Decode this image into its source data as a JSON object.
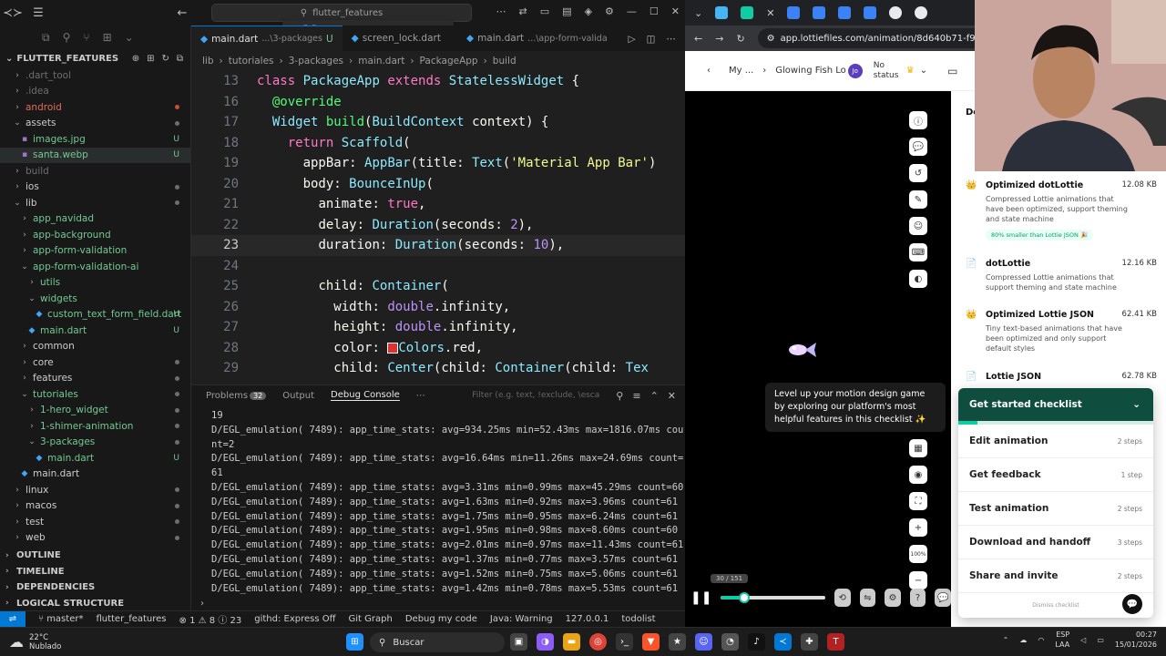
{
  "vscode": {
    "search": "flutter_features",
    "sidebar": {
      "title": "FLUTTER_FEATURES",
      "tree": [
        {
          "label": ".dart_tool",
          "indent": 1,
          "chev": "›",
          "color": "#6e6e6e",
          "mark": "",
          "dot": ""
        },
        {
          "label": ".idea",
          "indent": 1,
          "chev": "›",
          "color": "#6e6e6e",
          "mark": "",
          "dot": ""
        },
        {
          "label": "android",
          "indent": 1,
          "chev": "›",
          "color": "#e06c55",
          "mark": "",
          "dot": "red"
        },
        {
          "label": "assets",
          "indent": 1,
          "chev": "⌄",
          "color": "#cccccc",
          "mark": "",
          "dot": "gray"
        },
        {
          "label": "images.jpg",
          "indent": 2,
          "chev": "",
          "color": "#73c991",
          "mark": "U",
          "dot": ""
        },
        {
          "label": "santa.webp",
          "indent": 2,
          "chev": "",
          "color": "#73c991",
          "mark": "U",
          "dot": ""
        },
        {
          "label": "build",
          "indent": 1,
          "chev": "›",
          "color": "#6e6e6e",
          "mark": "",
          "dot": ""
        },
        {
          "label": "ios",
          "indent": 1,
          "chev": "›",
          "color": "#cccccc",
          "mark": "",
          "dot": "gray"
        },
        {
          "label": "lib",
          "indent": 1,
          "chev": "⌄",
          "color": "#cccccc",
          "mark": "",
          "dot": "gray"
        },
        {
          "label": "app_navidad",
          "indent": 2,
          "chev": "›",
          "color": "#73c991",
          "mark": "",
          "dot": ""
        },
        {
          "label": "app-background",
          "indent": 2,
          "chev": "›",
          "color": "#73c991",
          "mark": "",
          "dot": ""
        },
        {
          "label": "app-form-validation",
          "indent": 2,
          "chev": "›",
          "color": "#73c991",
          "mark": "",
          "dot": ""
        },
        {
          "label": "app-form-validation-ai",
          "indent": 2,
          "chev": "⌄",
          "color": "#73c991",
          "mark": "",
          "dot": ""
        },
        {
          "label": "utils",
          "indent": 3,
          "chev": "›",
          "color": "#73c991",
          "mark": "",
          "dot": ""
        },
        {
          "label": "widgets",
          "indent": 3,
          "chev": "⌄",
          "color": "#73c991",
          "mark": "",
          "dot": ""
        },
        {
          "label": "custom_text_form_field.dart",
          "indent": 4,
          "chev": "",
          "color": "#73c991",
          "mark": "U",
          "dot": ""
        },
        {
          "label": "main.dart",
          "indent": 3,
          "chev": "",
          "color": "#73c991",
          "mark": "U",
          "dot": ""
        },
        {
          "label": "common",
          "indent": 2,
          "chev": "›",
          "color": "#cccccc",
          "mark": "",
          "dot": ""
        },
        {
          "label": "core",
          "indent": 2,
          "chev": "›",
          "color": "#cccccc",
          "mark": "",
          "dot": "gray"
        },
        {
          "label": "features",
          "indent": 2,
          "chev": "›",
          "color": "#cccccc",
          "mark": "",
          "dot": "gray"
        },
        {
          "label": "tutoriales",
          "indent": 2,
          "chev": "⌄",
          "color": "#73c991",
          "mark": "",
          "dot": "gray"
        },
        {
          "label": "1-hero_widget",
          "indent": 3,
          "chev": "›",
          "color": "#73c991",
          "mark": "",
          "dot": "gray"
        },
        {
          "label": "1-shimer-animation",
          "indent": 3,
          "chev": "›",
          "color": "#73c991",
          "mark": "",
          "dot": "gray"
        },
        {
          "label": "3-packages",
          "indent": 3,
          "chev": "⌄",
          "color": "#73c991",
          "mark": "",
          "dot": "gray"
        },
        {
          "label": "main.dart",
          "indent": 4,
          "chev": "",
          "color": "#73c991",
          "mark": "U",
          "dot": ""
        },
        {
          "label": "main.dart",
          "indent": 2,
          "chev": "",
          "color": "#cccccc",
          "mark": "",
          "dot": ""
        },
        {
          "label": "linux",
          "indent": 1,
          "chev": "›",
          "color": "#cccccc",
          "mark": "",
          "dot": "gray"
        },
        {
          "label": "macos",
          "indent": 1,
          "chev": "›",
          "color": "#cccccc",
          "mark": "",
          "dot": "gray"
        },
        {
          "label": "test",
          "indent": 1,
          "chev": "›",
          "color": "#cccccc",
          "mark": "",
          "dot": "gray"
        },
        {
          "label": "web",
          "indent": 1,
          "chev": "›",
          "color": "#cccccc",
          "mark": "",
          "dot": "gray"
        }
      ],
      "sections": [
        "OUTLINE",
        "TIMELINE",
        "DEPENDENCIES",
        "LOGICAL STRUCTURE"
      ]
    },
    "tabs": [
      {
        "label": "main.dart",
        "path": "...\\3-packages",
        "mark": "U",
        "active": true
      },
      {
        "label": "screen_lock.dart",
        "path": "",
        "mark": "",
        "active": false
      },
      {
        "label": "main.dart",
        "path": "...\\app-form-valida",
        "mark": "",
        "active": false
      }
    ],
    "breadcrumbs": [
      "lib",
      "tutoriales",
      "3-packages",
      "main.dart",
      "PackageApp",
      "build"
    ],
    "code_lines": [
      {
        "n": "13",
        "html": "<span class='kw'>class</span> <span class='cls'>PackageApp</span> <span class='kw'>extends</span> <span class='cls'>StatelessWidget</span> <span class='id'>{</span>"
      },
      {
        "n": "16",
        "html": "  <span class='ann'>@override</span>"
      },
      {
        "n": "17",
        "html": "  <span class='cls'>Widget</span> <span class='fn'>build</span><span class='id'>(</span><span class='cls'>BuildContext</span> <span class='prm'>context</span><span class='id'>) {</span>"
      },
      {
        "n": "18",
        "html": "    <span class='kw'>return</span> <span class='cls'>Scaffold</span><span class='id'>(</span>"
      },
      {
        "n": "19",
        "html": "      <span class='id'>appBar:</span> <span class='cls'>AppBar</span><span class='id'>(title:</span> <span class='cls'>Text</span><span class='id'>(</span><span class='str'>'Material App Bar'</span><span class='id'>)</span>"
      },
      {
        "n": "20",
        "html": "      <span class='id'>body:</span> <span class='cls'>BounceInUp</span><span class='id'>(</span>"
      },
      {
        "n": "21",
        "html": "        <span class='id'>animate:</span> <span class='kw'>true</span><span class='id'>,</span>"
      },
      {
        "n": "22",
        "html": "        <span class='id'>delay:</span> <span class='cls'>Duration</span><span class='id'>(seconds:</span> <span class='num'>2</span><span class='id'>),</span>"
      },
      {
        "n": "23",
        "html": "        <span class='id'>duration:</span> <span class='cls'>Duration</span><span class='id'>(seconds:</span> <span class='num'>10</span><span class='id'>),</span>",
        "cur": true
      },
      {
        "n": "24",
        "html": ""
      },
      {
        "n": "25",
        "html": "        <span class='id'>child:</span> <span class='cls'>Container</span><span class='id'>(</span>"
      },
      {
        "n": "26",
        "html": "          <span class='id'>width:</span> <span class='kw2'>double</span><span class='id'>.infinity,</span>"
      },
      {
        "n": "27",
        "html": "          <span class='id'>height:</span> <span class='kw2'>double</span><span class='id'>.infinity,</span>"
      },
      {
        "n": "28",
        "html": "          <span class='id'>color:</span> <span style='display:inline-block;width:12px;height:12px;background:#e03030;border:1px solid #fff;vertical-align:middle'></span><span class='cls'>Colors</span><span class='id'>.red,</span>"
      },
      {
        "n": "29",
        "html": "          <span class='id'>child:</span> <span class='cls'>Center</span><span class='id'>(child:</span> <span class='cls'>Container</span><span class='id'>(child:</span> <span class='cls'>Tex</span>"
      }
    ],
    "panel": {
      "tabs": [
        "Problems",
        "Output",
        "Debug Console"
      ],
      "problems_count": "32",
      "active": "Debug Console",
      "filter_placeholder": "Filter (e.g. text, !exclude, \\escape)",
      "lines": [
        "19",
        "D/EGL_emulation( 7489): app_time_stats: avg=934.25ms min=52.43ms max=1816.07ms cou",
        "nt=2",
        "D/EGL_emulation( 7489): app_time_stats: avg=16.64ms min=11.26ms max=24.69ms count=",
        "61",
        "D/EGL_emulation( 7489): app_time_stats: avg=3.31ms min=0.99ms max=45.29ms count=60",
        "D/EGL_emulation( 7489): app_time_stats: avg=1.63ms min=0.92ms max=3.96ms count=61",
        "D/EGL_emulation( 7489): app_time_stats: avg=1.75ms min=0.95ms max=6.24ms count=61",
        "D/EGL_emulation( 7489): app_time_stats: avg=1.95ms min=0.98ms max=8.60ms count=60",
        "D/EGL_emulation( 7489): app_time_stats: avg=2.01ms min=0.97ms max=11.43ms count=61",
        "D/EGL_emulation( 7489): app_time_stats: avg=1.37ms min=0.77ms max=3.57ms count=61",
        "D/EGL_emulation( 7489): app_time_stats: avg=1.52ms min=0.75ms max=5.06ms count=61",
        "D/EGL_emulation( 7489): app_time_stats: avg=1.42ms min=0.78ms max=5.53ms count=61"
      ]
    },
    "status": {
      "branch": "master*",
      "project": "flutter_features",
      "errors": "1",
      "warnings": "8",
      "infos": "23",
      "githd": "githd: Express Off",
      "gitgraph": "Git Graph",
      "debug": "Debug my code",
      "java": "Java: Warning",
      "ip": "127.0.0.1",
      "todo": "todolist"
    }
  },
  "browser": {
    "url": "app.lottiefiles.com/animation/8d640b71-f91e-42c5-",
    "nav": {
      "crumb1": "My ...",
      "crumb2": "Glowing Fish Lo",
      "avatar": "Jo",
      "status": "No status"
    },
    "tooltip": "Level up your motion design game by exploring our platform's most helpful features in this checklist ✨",
    "frame": "30 / 151",
    "progress": 0.22,
    "zoom": "100%",
    "downloads_header": "Do",
    "downloads": [
      {
        "title": "Optimized dotLottie",
        "desc": "Compressed Lottie animations that have been optimized, support theming and state machine",
        "size": "12.08 KB",
        "tag": "80% smaller than Lottie JSON 🎉",
        "icon": "👑"
      },
      {
        "title": "dotLottie",
        "desc": "Compressed Lottie animations that support theming and state machine",
        "size": "12.16 KB",
        "tag": "",
        "icon": "📄"
      },
      {
        "title": "Optimized Lottie JSON",
        "desc": "Tiny text-based animations that have been optimized and only support default styles",
        "size": "62.41 KB",
        "tag": "",
        "icon": "👑"
      },
      {
        "title": "Lottie JSON",
        "desc": "",
        "size": "62.78 KB",
        "tag": "",
        "icon": "📄"
      }
    ],
    "checklist": {
      "title": "Get started checklist",
      "progress": 0.1,
      "items": [
        {
          "label": "Edit animation",
          "steps": "2 steps"
        },
        {
          "label": "Get feedback",
          "steps": "1 step"
        },
        {
          "label": "Test animation",
          "steps": "2 steps"
        },
        {
          "label": "Download and handoff",
          "steps": "3 steps"
        },
        {
          "label": "Share and invite",
          "steps": "2 steps"
        }
      ],
      "dismiss": "Dismiss checklist"
    }
  },
  "taskbar": {
    "temp": "22°C",
    "weather": "Nublado",
    "search": "Buscar",
    "lang": "ESP",
    "lang2": "LAA",
    "time": "00:27",
    "date": "15/01/2026"
  }
}
